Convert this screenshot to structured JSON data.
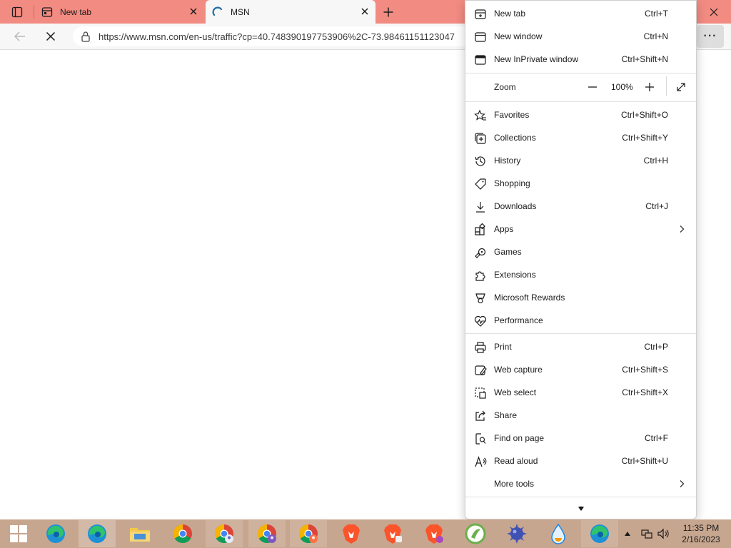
{
  "tabs": [
    {
      "title": "New tab",
      "active": false
    },
    {
      "title": "MSN",
      "active": true
    }
  ],
  "address": {
    "url": "https://www.msn.com/en-us/traffic?cp=40.748390197753906%2C-73.98461151123047"
  },
  "menu": {
    "items_top": [
      {
        "label": "New tab",
        "shortcut": "Ctrl+T",
        "icon": "new-tab-icon"
      },
      {
        "label": "New window",
        "shortcut": "Ctrl+N",
        "icon": "new-window-icon"
      },
      {
        "label": "New InPrivate window",
        "shortcut": "Ctrl+Shift+N",
        "icon": "inprivate-icon"
      }
    ],
    "zoom": {
      "label": "Zoom",
      "value": "100%"
    },
    "items_mid": [
      {
        "label": "Favorites",
        "shortcut": "Ctrl+Shift+O",
        "icon": "favorites-icon"
      },
      {
        "label": "Collections",
        "shortcut": "Ctrl+Shift+Y",
        "icon": "collections-icon"
      },
      {
        "label": "History",
        "shortcut": "Ctrl+H",
        "icon": "history-icon"
      },
      {
        "label": "Shopping",
        "shortcut": "",
        "icon": "shopping-tag-icon"
      },
      {
        "label": "Downloads",
        "shortcut": "Ctrl+J",
        "icon": "download-icon"
      },
      {
        "label": "Apps",
        "shortcut": "",
        "icon": "apps-icon"
      },
      {
        "label": "Games",
        "shortcut": "",
        "icon": "games-icon"
      },
      {
        "label": "Extensions",
        "shortcut": "",
        "icon": "extensions-icon"
      },
      {
        "label": "Microsoft Rewards",
        "shortcut": "",
        "icon": "rewards-icon"
      },
      {
        "label": "Performance",
        "shortcut": "",
        "icon": "performance-icon"
      }
    ],
    "items_bottom": [
      {
        "label": "Print",
        "shortcut": "Ctrl+P",
        "icon": "print-icon"
      },
      {
        "label": "Web capture",
        "shortcut": "Ctrl+Shift+S",
        "icon": "web-capture-icon"
      },
      {
        "label": "Web select",
        "shortcut": "Ctrl+Shift+X",
        "icon": "web-select-icon"
      },
      {
        "label": "Share",
        "shortcut": "",
        "icon": "share-icon"
      },
      {
        "label": "Find on page",
        "shortcut": "Ctrl+F",
        "icon": "find-icon"
      },
      {
        "label": "Read aloud",
        "shortcut": "Ctrl+Shift+U",
        "icon": "read-aloud-icon"
      },
      {
        "label": "More tools",
        "shortcut": "",
        "icon": "more-tools-icon"
      }
    ]
  },
  "taskbar": {
    "clock": {
      "time": "11:35 PM",
      "date": "2/16/2023"
    }
  }
}
